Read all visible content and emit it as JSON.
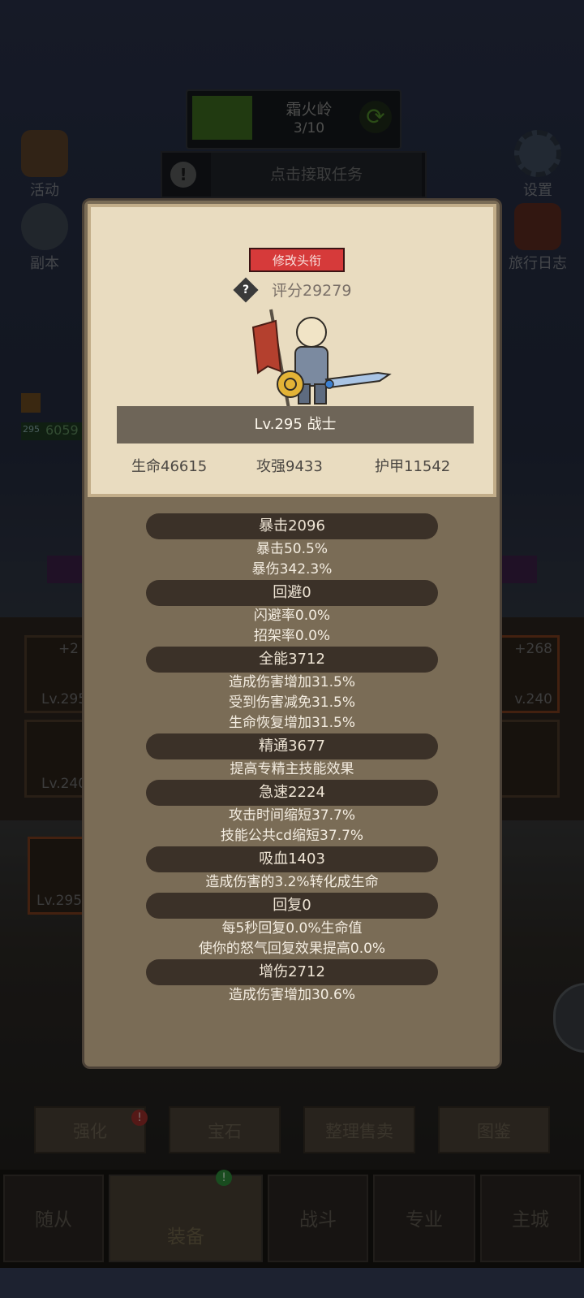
{
  "zone": {
    "name": "霜火岭",
    "progress": "3/10"
  },
  "quest": {
    "alert_glyph": "!",
    "text": "点击接取任务"
  },
  "side_buttons": {
    "activities": "活动",
    "dungeon": "副本",
    "settings": "设置",
    "travel_log": "旅行日志"
  },
  "background_slots": {
    "slot1_bonus": "+2",
    "slot1_level": "Lv.295",
    "slot2_level": "Lv.240",
    "slot3_bonus": "+268",
    "slot3_level": "v.240",
    "slot4_level": "Lv.295",
    "player_level": "295",
    "player_value": "6059"
  },
  "actions": {
    "enhance": "强化",
    "gem": "宝石",
    "sort_sell": "整理售卖",
    "codex": "图鉴"
  },
  "notification_glyph": "!",
  "bottom_tabs": [
    "随从",
    "装备",
    "战斗",
    "专业",
    "主城"
  ],
  "popup": {
    "edit_title_button": "修改头衔",
    "help_glyph": "?",
    "score": "评分29279",
    "level_class": "Lv.295 战士",
    "basic_stats": {
      "hp": "生命46615",
      "attack": "攻强9433",
      "armor": "护甲11542"
    },
    "stats": [
      {
        "header": "暴击2096",
        "lines": [
          "暴击50.5%",
          "暴伤342.3%"
        ]
      },
      {
        "header": "回避0",
        "lines": [
          "闪避率0.0%",
          "招架率0.0%"
        ]
      },
      {
        "header": "全能3712",
        "lines": [
          "造成伤害增加31.5%",
          "受到伤害减免31.5%",
          "生命恢复增加31.5%"
        ]
      },
      {
        "header": "精通3677",
        "lines": [
          "提高专精主技能效果"
        ]
      },
      {
        "header": "急速2224",
        "lines": [
          "攻击时间缩短37.7%",
          "技能公共cd缩短37.7%"
        ]
      },
      {
        "header": "吸血1403",
        "lines": [
          "造成伤害的3.2%转化成生命"
        ]
      },
      {
        "header": "回复0",
        "lines": [
          "每5秒回复0.0%生命值",
          "使你的怒气回复效果提高0.0%"
        ]
      },
      {
        "header": "增伤2712",
        "lines": [
          "造成伤害增加30.6%"
        ]
      }
    ]
  },
  "colors": {
    "title_button": "#d63a3a",
    "popup_frame": "#7a6c56",
    "header_card": "#e9dcc0",
    "stat_pill": "#3b3128"
  }
}
